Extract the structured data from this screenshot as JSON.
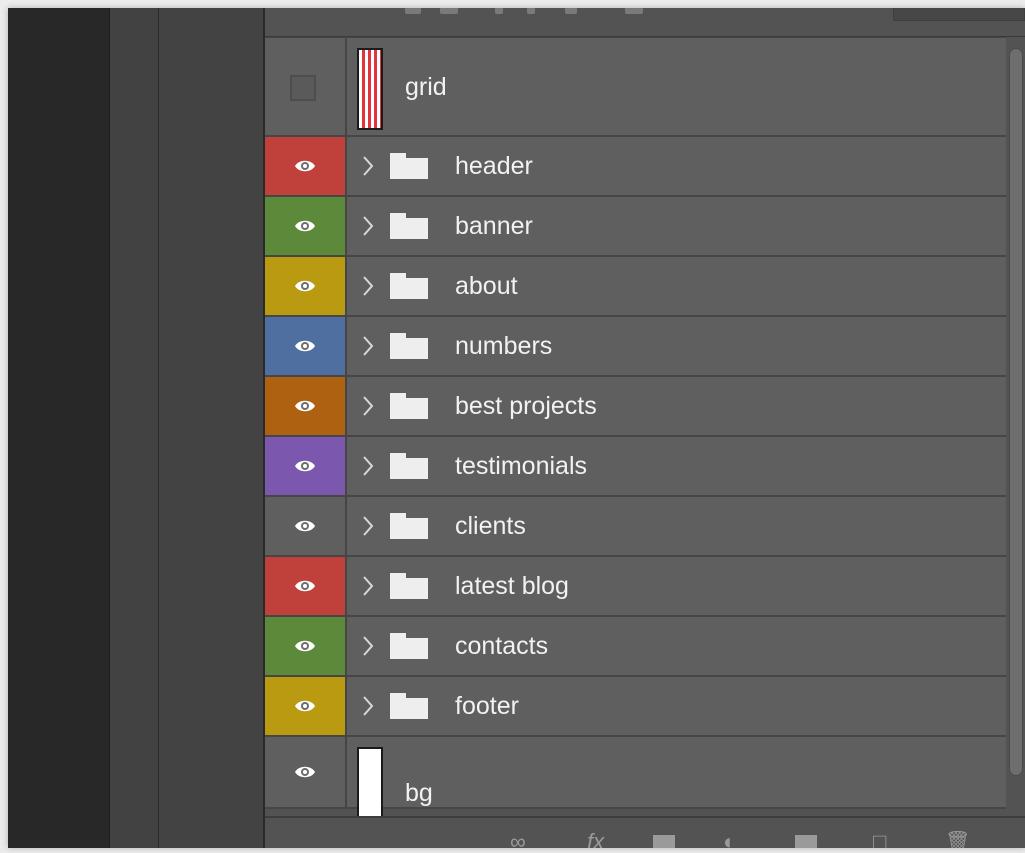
{
  "colors": {
    "red": "#c0413b",
    "green": "#5c8a3a",
    "yellow": "#b99a10",
    "blue": "#4f6fa0",
    "orange": "#ae6211",
    "violet": "#7b58ad",
    "none": "#5f5f5f"
  },
  "layers": [
    {
      "name": "grid",
      "kind": "layer",
      "visible": false,
      "thumb": "grid-stripes"
    },
    {
      "name": "header",
      "kind": "group",
      "visible": true,
      "color": "red"
    },
    {
      "name": "banner",
      "kind": "group",
      "visible": true,
      "color": "green"
    },
    {
      "name": "about",
      "kind": "group",
      "visible": true,
      "color": "yellow"
    },
    {
      "name": "numbers",
      "kind": "group",
      "visible": true,
      "color": "blue"
    },
    {
      "name": "best projects",
      "kind": "group",
      "visible": true,
      "color": "orange"
    },
    {
      "name": "testimonials",
      "kind": "group",
      "visible": true,
      "color": "violet"
    },
    {
      "name": "clients",
      "kind": "group",
      "visible": true,
      "color": "none"
    },
    {
      "name": "latest blog",
      "kind": "group",
      "visible": true,
      "color": "red"
    },
    {
      "name": "contacts",
      "kind": "group",
      "visible": true,
      "color": "green"
    },
    {
      "name": "footer",
      "kind": "group",
      "visible": true,
      "color": "yellow"
    },
    {
      "name": "bg",
      "kind": "layer",
      "visible": true,
      "thumb": "white"
    }
  ],
  "bottom_icons": [
    "link-icon",
    "fx-icon",
    "mask-icon",
    "adjustment-icon",
    "new-group-icon",
    "new-layer-icon",
    "trash-icon"
  ]
}
